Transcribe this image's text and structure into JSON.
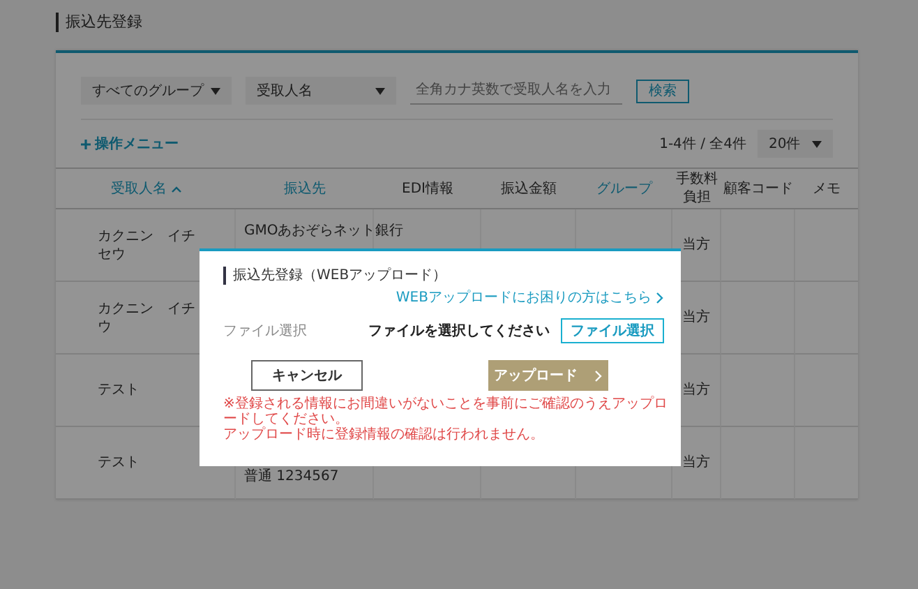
{
  "page": {
    "title": "振込先登録"
  },
  "filters": {
    "group_select": "すべてのグループ",
    "field_select": "受取人名",
    "search": {
      "placeholder": "全角カナ英数で受取人名を入力"
    },
    "search_button": "検索"
  },
  "toolbar": {
    "menu_link": "操作メニュー",
    "count": "1-4件 / 全4件",
    "page_size": "20件"
  },
  "table": {
    "columns": [
      {
        "label": "受取人名",
        "link": true,
        "sorted": true
      },
      {
        "label": "振込先",
        "link": true,
        "sorted": false
      },
      {
        "label": "EDI情報",
        "link": false,
        "sorted": false
      },
      {
        "label": "振込金額",
        "link": false,
        "sorted": false
      },
      {
        "label": "グループ",
        "link": true,
        "sorted": false
      },
      {
        "label": "手数料負担",
        "link": false,
        "sorted": false
      },
      {
        "label": "顧客コード",
        "link": false,
        "sorted": false
      },
      {
        "label": "メモ",
        "link": false,
        "sorted": false
      }
    ],
    "rows": [
      {
        "name": "カクニン　イチセウ",
        "bank": "GMOあおぞらネット銀行",
        "fee": "当方"
      },
      {
        "name": "カクニン　イチウ",
        "bank": "",
        "fee": "当方"
      },
      {
        "name": "テスト",
        "bank": "",
        "fee": "当方"
      },
      {
        "name": "テスト",
        "bank": "普通 1234567",
        "fee": "当方"
      }
    ]
  },
  "modal": {
    "title": "振込先登録（WEBアップロード）",
    "help_link": "WEBアップロードにお困りの方はこちら",
    "field_label": "ファイル選択",
    "field_value": "ファイルを選択してください",
    "file_button": "ファイル選択",
    "cancel_button": "キャンセル",
    "upload_button": "アップロード",
    "notes": [
      "※登録される情報にお間違いがないことを事前にご確認のうえアップロードしてください。",
      "アップロード時に登録情報の確認は行われません。"
    ]
  }
}
